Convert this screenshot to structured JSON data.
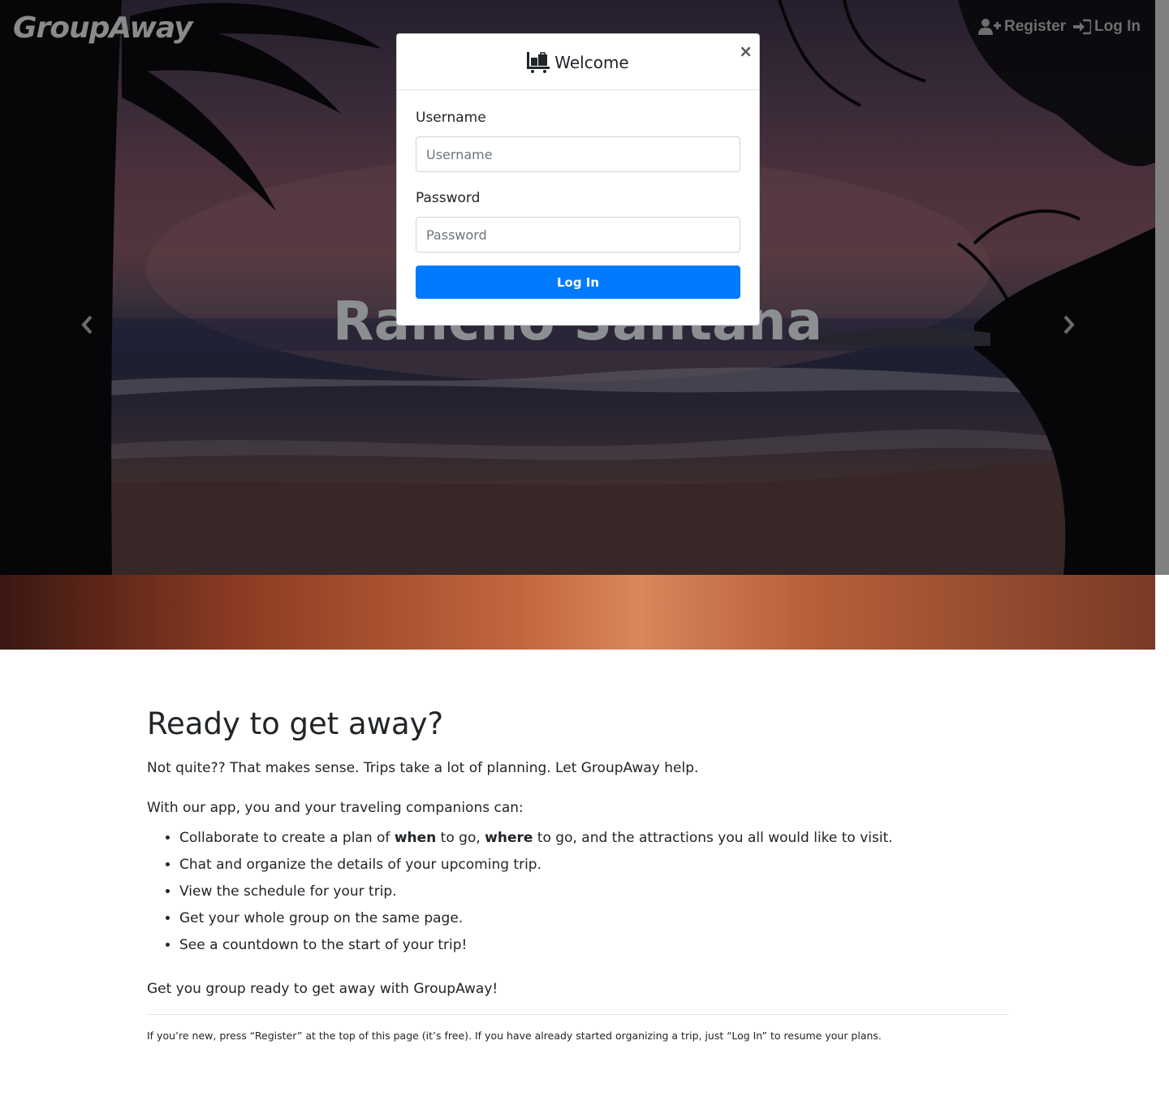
{
  "navbar": {
    "brand": "GroupAway",
    "register_label": "Register",
    "login_label": "Log In"
  },
  "carousel": {
    "caption": "Rancho Santana"
  },
  "modal": {
    "title": "Welcome",
    "close_label": "×",
    "username_label": "Username",
    "username_placeholder": "Username",
    "password_label": "Password",
    "password_placeholder": "Password",
    "submit_label": "Log In"
  },
  "content": {
    "heading": "Ready to get away?",
    "intro": "Not quite?? That makes sense. Trips take a lot of planning. Let GroupAway help.",
    "with_text": "With our app, you and your traveling companions can:",
    "feature_1": {
      "part1": "Collaborate to create a plan of ",
      "bold1": "when",
      "part2": " to go, ",
      "bold2": "where",
      "part3": " to go, and the attractions you all would like to visit."
    },
    "features": [
      "Chat and organize the details of your upcoming trip.",
      "View the schedule for your trip.",
      "Get your whole group on the same page.",
      "See a countdown to the start of your trip!"
    ],
    "closing": "Get you group ready to get away with GroupAway!",
    "note": "If you’re new, press “Register” at the top of this page (it’s free). If you have already started organizing a trip, just “Log In” to resume your plans."
  },
  "colors": {
    "primary": "#007bff",
    "text": "#212529"
  },
  "icons": {
    "register": "user-plus-icon",
    "login": "sign-in-icon",
    "modal": "luggage-cart-icon",
    "prev": "chevron-left-icon",
    "next": "chevron-right-icon"
  }
}
